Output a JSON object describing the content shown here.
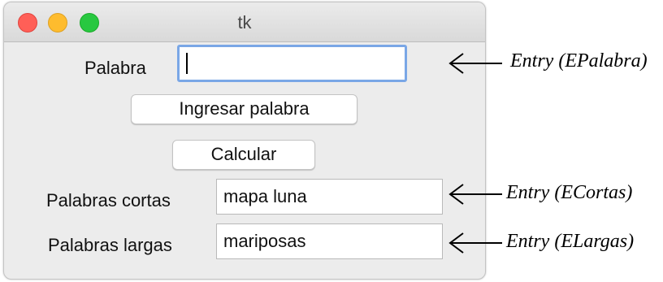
{
  "window": {
    "title": "tk"
  },
  "form": {
    "palabra_label": "Palabra",
    "palabra_value": "",
    "ingresar_button": "Ingresar palabra",
    "calcular_button": "Calcular",
    "cortas_label": "Palabras cortas",
    "cortas_value": "mapa luna",
    "largas_label": "Palabras largas",
    "largas_value": "mariposas"
  },
  "annotations": {
    "epalabra": "Entry (EPalabra)",
    "ecortas": "Entry (ECortas)",
    "elargas": "Entry (ELargas)"
  },
  "colors": {
    "close": "#ff5f57",
    "minimize": "#febc2e",
    "maximize": "#28c840",
    "focus_ring": "#7aa7e6",
    "window_bg": "#ececec"
  },
  "icons": {
    "annotation_pointer": "left-arrow-icon"
  }
}
